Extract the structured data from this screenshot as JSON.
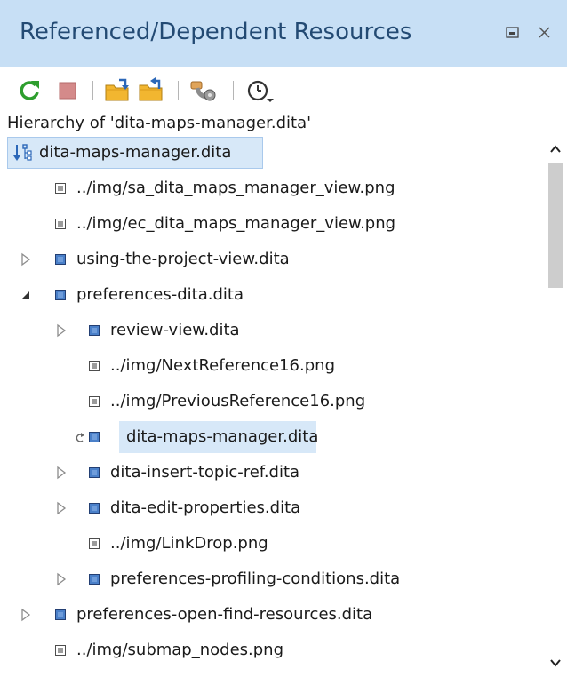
{
  "panel": {
    "title": "Referenced/Dependent Resources",
    "minimize_icon": "minimize-icon",
    "close_icon": "close-icon"
  },
  "toolbar": {
    "buttons": [
      {
        "name": "refresh-button",
        "icon": "refresh-icon",
        "color": "#2e9e2e"
      },
      {
        "name": "stop-button",
        "icon": "stop-icon",
        "color": "#d48a8a"
      },
      {
        "name": "show-references-button",
        "icon": "folder-references-icon",
        "color": "#f2b630"
      },
      {
        "name": "show-dependencies-button",
        "icon": "folder-dependencies-icon",
        "color": "#f2b630"
      },
      {
        "name": "configure-button",
        "icon": "pipe-configure-icon",
        "color": "#c9873b"
      },
      {
        "name": "history-button",
        "icon": "history-clock-icon",
        "color": "#333333"
      }
    ]
  },
  "hierarchy_label": "Hierarchy of 'dita-maps-manager.dita'",
  "tree": {
    "rows": [
      {
        "label": "dita-maps-manager.dita",
        "level": 0,
        "twisty": "none",
        "icon": "hierarchy-icon",
        "selected": true
      },
      {
        "label": "../img/sa_dita_maps_manager_view.png",
        "level": 1,
        "twisty": "none",
        "icon": "resource"
      },
      {
        "label": "../img/ec_dita_maps_manager_view.png",
        "level": 1,
        "twisty": "none",
        "icon": "resource"
      },
      {
        "label": "using-the-project-view.dita",
        "level": 1,
        "twisty": "collapsed",
        "icon": "map"
      },
      {
        "label": "preferences-dita.dita",
        "level": 1,
        "twisty": "expanded",
        "icon": "map"
      },
      {
        "label": "review-view.dita",
        "level": 2,
        "twisty": "collapsed",
        "icon": "map"
      },
      {
        "label": "../img/NextReference16.png",
        "level": 2,
        "twisty": "none",
        "icon": "resource"
      },
      {
        "label": "../img/PreviousReference16.png",
        "level": 2,
        "twisty": "none",
        "icon": "resource"
      },
      {
        "label": "dita-maps-manager.dita",
        "level": 2,
        "twisty": "none",
        "icon": "map",
        "recursive": true,
        "highlight": true
      },
      {
        "label": "dita-insert-topic-ref.dita",
        "level": 2,
        "twisty": "collapsed",
        "icon": "map"
      },
      {
        "label": "dita-edit-properties.dita",
        "level": 2,
        "twisty": "collapsed",
        "icon": "map"
      },
      {
        "label": "../img/LinkDrop.png",
        "level": 2,
        "twisty": "none",
        "icon": "resource"
      },
      {
        "label": "preferences-profiling-conditions.dita",
        "level": 2,
        "twisty": "collapsed",
        "icon": "map"
      },
      {
        "label": "preferences-open-find-resources.dita",
        "level": 1,
        "twisty": "collapsed",
        "icon": "map"
      },
      {
        "label": "../img/submap_nodes.png",
        "level": 1,
        "twisty": "none",
        "icon": "resource"
      }
    ]
  },
  "colors": {
    "title_bg": "#c7dff5",
    "title_text": "#234a73",
    "selection_bg": "#d7e8f8",
    "map_icon": "#4a80c9"
  }
}
